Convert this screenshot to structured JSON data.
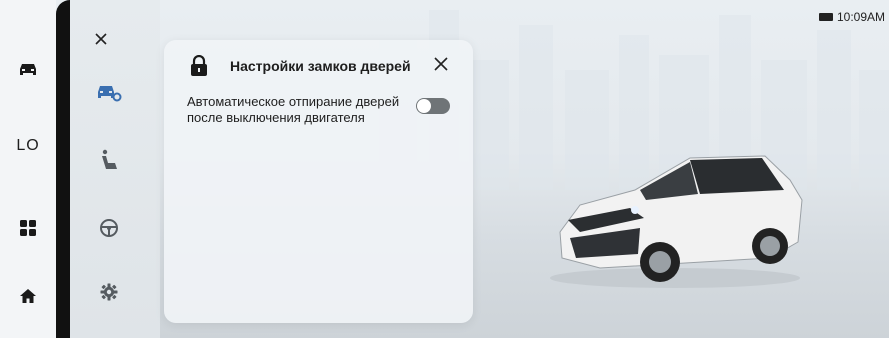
{
  "status_bar": {
    "time": "10:09AM",
    "battery_icon": "battery-icon"
  },
  "rail": {
    "items": [
      {
        "name": "car-icon"
      },
      {
        "label": "LO"
      },
      {
        "name": "apps-grid-icon"
      },
      {
        "name": "home-icon"
      }
    ]
  },
  "side_menu": {
    "close_icon": "close-icon",
    "items": [
      {
        "name": "car-settings-icon",
        "active": true
      },
      {
        "name": "seat-icon"
      },
      {
        "name": "steering-wheel-icon"
      },
      {
        "name": "gear-icon"
      }
    ]
  },
  "dialog": {
    "title": "Настройки замков дверей",
    "icon": "lock-icon",
    "setting_line1": "Автоматическое отпирание дверей",
    "setting_line2": "после выключения двигателя",
    "toggle_state": "off"
  },
  "colors": {
    "accent": "#3a6fb0",
    "icon_gray": "#555b60",
    "dark": "#111111"
  }
}
